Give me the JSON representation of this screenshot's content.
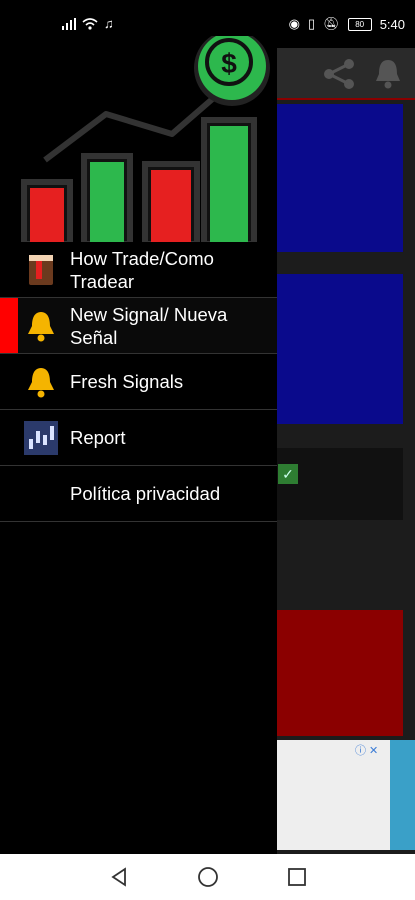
{
  "status": {
    "time": "5:40",
    "battery": "80"
  },
  "menu": {
    "items": [
      {
        "label": "How Trade/Como Tradear",
        "icon": "book-icon"
      },
      {
        "label": "New Signal/ Nueva Señal",
        "icon": "bell-icon"
      },
      {
        "label": "Fresh Signals",
        "icon": "bell-icon"
      },
      {
        "label": "Report",
        "icon": "chart-icon"
      },
      {
        "label": "Política privacidad",
        "icon": ""
      }
    ]
  },
  "colors": {
    "accent_red": "#ff0000",
    "card_blue": "#0a0a8c",
    "card_red": "#8b0000",
    "green": "#2db84d"
  }
}
